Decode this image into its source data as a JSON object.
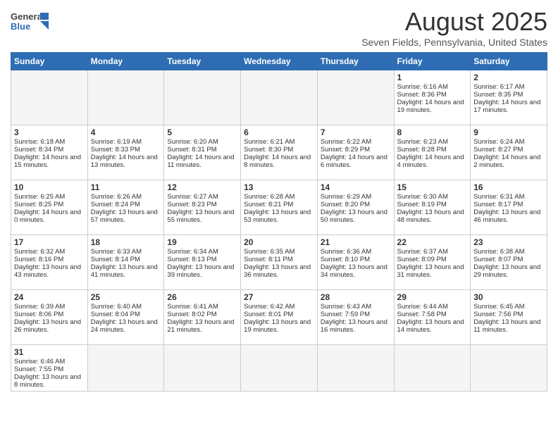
{
  "logo": {
    "text_general": "General",
    "text_blue": "Blue"
  },
  "header": {
    "month_year": "August 2025",
    "location": "Seven Fields, Pennsylvania, United States"
  },
  "days_of_week": [
    "Sunday",
    "Monday",
    "Tuesday",
    "Wednesday",
    "Thursday",
    "Friday",
    "Saturday"
  ],
  "weeks": [
    [
      {
        "day": "",
        "content": ""
      },
      {
        "day": "",
        "content": ""
      },
      {
        "day": "",
        "content": ""
      },
      {
        "day": "",
        "content": ""
      },
      {
        "day": "",
        "content": ""
      },
      {
        "day": "1",
        "content": "Sunrise: 6:16 AM\nSunset: 8:36 PM\nDaylight: 14 hours and 19 minutes."
      },
      {
        "day": "2",
        "content": "Sunrise: 6:17 AM\nSunset: 8:35 PM\nDaylight: 14 hours and 17 minutes."
      }
    ],
    [
      {
        "day": "3",
        "content": "Sunrise: 6:18 AM\nSunset: 8:34 PM\nDaylight: 14 hours and 15 minutes."
      },
      {
        "day": "4",
        "content": "Sunrise: 6:19 AM\nSunset: 8:33 PM\nDaylight: 14 hours and 13 minutes."
      },
      {
        "day": "5",
        "content": "Sunrise: 6:20 AM\nSunset: 8:31 PM\nDaylight: 14 hours and 11 minutes."
      },
      {
        "day": "6",
        "content": "Sunrise: 6:21 AM\nSunset: 8:30 PM\nDaylight: 14 hours and 8 minutes."
      },
      {
        "day": "7",
        "content": "Sunrise: 6:22 AM\nSunset: 8:29 PM\nDaylight: 14 hours and 6 minutes."
      },
      {
        "day": "8",
        "content": "Sunrise: 6:23 AM\nSunset: 8:28 PM\nDaylight: 14 hours and 4 minutes."
      },
      {
        "day": "9",
        "content": "Sunrise: 6:24 AM\nSunset: 8:27 PM\nDaylight: 14 hours and 2 minutes."
      }
    ],
    [
      {
        "day": "10",
        "content": "Sunrise: 6:25 AM\nSunset: 8:25 PM\nDaylight: 14 hours and 0 minutes."
      },
      {
        "day": "11",
        "content": "Sunrise: 6:26 AM\nSunset: 8:24 PM\nDaylight: 13 hours and 57 minutes."
      },
      {
        "day": "12",
        "content": "Sunrise: 6:27 AM\nSunset: 8:23 PM\nDaylight: 13 hours and 55 minutes."
      },
      {
        "day": "13",
        "content": "Sunrise: 6:28 AM\nSunset: 8:21 PM\nDaylight: 13 hours and 53 minutes."
      },
      {
        "day": "14",
        "content": "Sunrise: 6:29 AM\nSunset: 8:20 PM\nDaylight: 13 hours and 50 minutes."
      },
      {
        "day": "15",
        "content": "Sunrise: 6:30 AM\nSunset: 8:19 PM\nDaylight: 13 hours and 48 minutes."
      },
      {
        "day": "16",
        "content": "Sunrise: 6:31 AM\nSunset: 8:17 PM\nDaylight: 13 hours and 46 minutes."
      }
    ],
    [
      {
        "day": "17",
        "content": "Sunrise: 6:32 AM\nSunset: 8:16 PM\nDaylight: 13 hours and 43 minutes."
      },
      {
        "day": "18",
        "content": "Sunrise: 6:33 AM\nSunset: 8:14 PM\nDaylight: 13 hours and 41 minutes."
      },
      {
        "day": "19",
        "content": "Sunrise: 6:34 AM\nSunset: 8:13 PM\nDaylight: 13 hours and 39 minutes."
      },
      {
        "day": "20",
        "content": "Sunrise: 6:35 AM\nSunset: 8:11 PM\nDaylight: 13 hours and 36 minutes."
      },
      {
        "day": "21",
        "content": "Sunrise: 6:36 AM\nSunset: 8:10 PM\nDaylight: 13 hours and 34 minutes."
      },
      {
        "day": "22",
        "content": "Sunrise: 6:37 AM\nSunset: 8:09 PM\nDaylight: 13 hours and 31 minutes."
      },
      {
        "day": "23",
        "content": "Sunrise: 6:38 AM\nSunset: 8:07 PM\nDaylight: 13 hours and 29 minutes."
      }
    ],
    [
      {
        "day": "24",
        "content": "Sunrise: 6:39 AM\nSunset: 8:06 PM\nDaylight: 13 hours and 26 minutes."
      },
      {
        "day": "25",
        "content": "Sunrise: 6:40 AM\nSunset: 8:04 PM\nDaylight: 13 hours and 24 minutes."
      },
      {
        "day": "26",
        "content": "Sunrise: 6:41 AM\nSunset: 8:02 PM\nDaylight: 13 hours and 21 minutes."
      },
      {
        "day": "27",
        "content": "Sunrise: 6:42 AM\nSunset: 8:01 PM\nDaylight: 13 hours and 19 minutes."
      },
      {
        "day": "28",
        "content": "Sunrise: 6:43 AM\nSunset: 7:59 PM\nDaylight: 13 hours and 16 minutes."
      },
      {
        "day": "29",
        "content": "Sunrise: 6:44 AM\nSunset: 7:58 PM\nDaylight: 13 hours and 14 minutes."
      },
      {
        "day": "30",
        "content": "Sunrise: 6:45 AM\nSunset: 7:56 PM\nDaylight: 13 hours and 11 minutes."
      }
    ],
    [
      {
        "day": "31",
        "content": "Sunrise: 6:46 AM\nSunset: 7:55 PM\nDaylight: 13 hours and 8 minutes."
      },
      {
        "day": "",
        "content": ""
      },
      {
        "day": "",
        "content": ""
      },
      {
        "day": "",
        "content": ""
      },
      {
        "day": "",
        "content": ""
      },
      {
        "day": "",
        "content": ""
      },
      {
        "day": "",
        "content": ""
      }
    ]
  ]
}
